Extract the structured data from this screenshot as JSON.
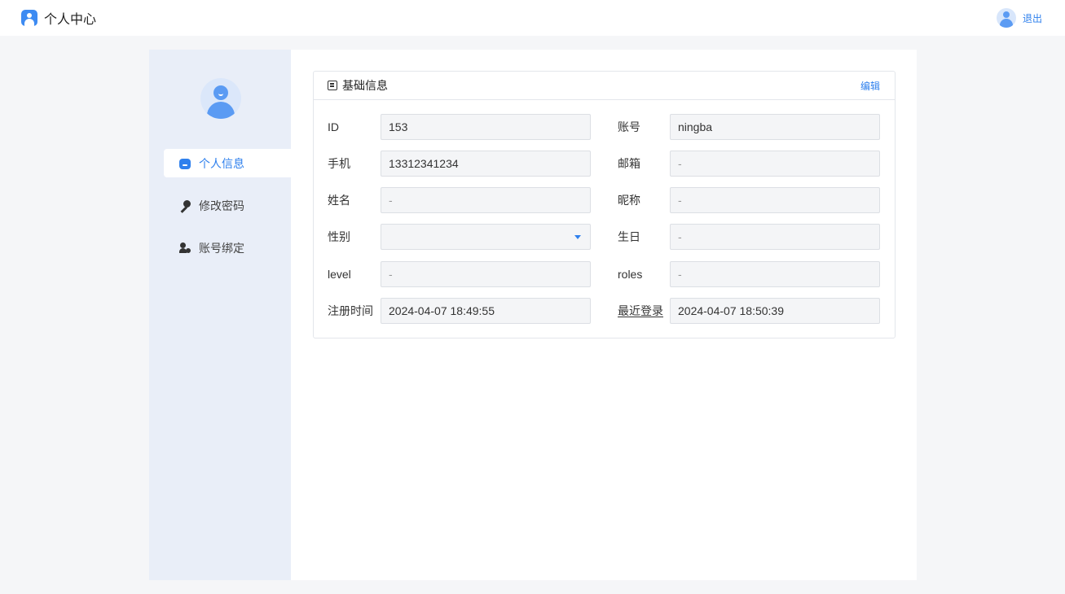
{
  "header": {
    "title": "个人中心",
    "logout_label": "退出"
  },
  "sidebar": {
    "items": [
      {
        "label": "个人信息",
        "icon": "home-icon",
        "active": true
      },
      {
        "label": "修改密码",
        "icon": "key-icon",
        "active": false
      },
      {
        "label": "账号绑定",
        "icon": "user-check-icon",
        "active": false
      }
    ]
  },
  "panel": {
    "title": "基础信息",
    "edit_label": "编辑",
    "fields": {
      "id": {
        "label": "ID",
        "value": "153"
      },
      "account": {
        "label": "账号",
        "value": "ningba"
      },
      "phone": {
        "label": "手机",
        "value": "13312341234"
      },
      "email": {
        "label": "邮箱",
        "value": "-"
      },
      "name": {
        "label": "姓名",
        "value": "-"
      },
      "nickname": {
        "label": "昵称",
        "value": "-"
      },
      "gender": {
        "label": "性别",
        "value": ""
      },
      "birthday": {
        "label": "生日",
        "value": "-"
      },
      "level": {
        "label": "level",
        "value": "-"
      },
      "roles": {
        "label": "roles",
        "value": "-"
      },
      "register_time": {
        "label": "注册时间",
        "value": "2024-04-07 18:49:55"
      },
      "last_login": {
        "label": "最近登录",
        "value": "2024-04-07 18:50:39"
      }
    }
  },
  "colors": {
    "accent": "#2f80ed",
    "sidebar_bg": "#e9eef8",
    "page_bg": "#f5f6f8",
    "field_bg": "#f4f5f7"
  }
}
